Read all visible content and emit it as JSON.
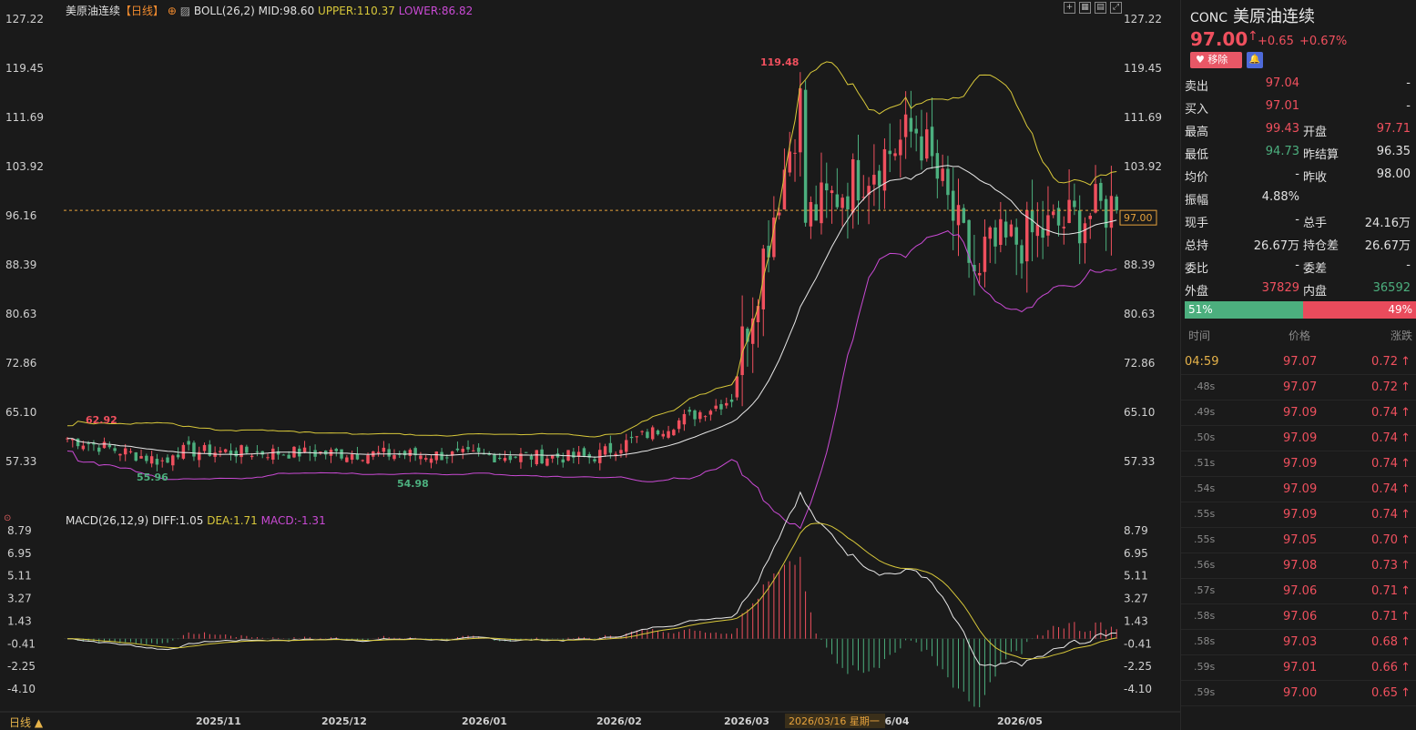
{
  "chart_header": {
    "symbol_label": "美原油连续",
    "period_label": "【日线】",
    "add_icon": "plus-circle-icon",
    "boll_label": "BOLL(26,2)",
    "boll_mid": "MID:98.60",
    "boll_upper": "UPPER:110.37",
    "boll_lower": "LOWER:86.82",
    "macd_label": "MACD(26,12,9)",
    "macd_diff": "DIFF:1.05",
    "macd_dea": "DEA:1.71",
    "macd_macd": "MACD:-1.31",
    "bottom_tab": "日线 ▲",
    "cursor_date": "2026/03/16 星期一"
  },
  "chart_data": [
    {
      "type": "candlestick",
      "title": "美原油连续【日线】",
      "y_ticks": [
        "127.22",
        "119.45",
        "111.69",
        "103.92",
        "96.16",
        "88.39",
        "80.63",
        "72.86",
        "65.10",
        "57.33"
      ],
      "ylim": [
        57.33,
        127.22
      ],
      "x_ticks": [
        "2025/11",
        "2025/12",
        "2026/01",
        "2026/02",
        "2026/03",
        "6/04",
        "2026/05"
      ],
      "annotations": [
        {
          "label": "119.48",
          "color": "#f0505e"
        },
        {
          "label": "62.92",
          "color": "#f0505e"
        },
        {
          "label": "55.96",
          "color": "#4caf7e"
        },
        {
          "label": "54.98",
          "color": "#4caf7e"
        }
      ],
      "current_price_label": "97.00",
      "current_price": 97.0,
      "series": [
        {
          "name": "UPPER",
          "color": "#d8c83a"
        },
        {
          "name": "MID",
          "color": "#e8e8e8"
        },
        {
          "name": "LOWER",
          "color": "#c94ad4"
        }
      ],
      "phases": [
        {
          "start": 0,
          "end": 0.1,
          "from": 61,
          "to": 57
        },
        {
          "start": 0.1,
          "end": 0.5,
          "from": 59,
          "to": 58
        },
        {
          "start": 0.5,
          "end": 0.63,
          "from": 58,
          "to": 67
        },
        {
          "start": 0.63,
          "end": 0.7,
          "from": 67,
          "to": 115
        },
        {
          "start": 0.7,
          "end": 0.81,
          "from": 95,
          "to": 110
        },
        {
          "start": 0.81,
          "end": 0.87,
          "from": 110,
          "to": 85
        },
        {
          "start": 0.87,
          "end": 1,
          "from": 90,
          "to": 98
        }
      ]
    },
    {
      "type": "bar",
      "title": "MACD(26,12,9)",
      "y_ticks": [
        "8.79",
        "6.95",
        "5.11",
        "3.27",
        "1.43",
        "-0.41",
        "-2.25",
        "-4.10"
      ],
      "ylim": [
        -4.1,
        8.79
      ],
      "series": [
        {
          "name": "DIFF",
          "color": "#e8e8e8"
        },
        {
          "name": "DEA",
          "color": "#d8c83a"
        },
        {
          "name": "MACD",
          "color": "#c94ad4"
        }
      ]
    }
  ],
  "panel": {
    "code": "CONC",
    "name": "美原油连续",
    "price": "97.00",
    "arrow": "↑",
    "change": "+0.65",
    "change_pct": "+0.67%",
    "remove_label": "移除",
    "remove_icon": "heart-icon",
    "bell_icon": "bell-icon",
    "quotes": [
      {
        "l1": "卖出",
        "v1": "97.04",
        "c1": "red",
        "l2": "",
        "v2": "-",
        "c2": "white"
      },
      {
        "l1": "买入",
        "v1": "97.01",
        "c1": "red",
        "l2": "",
        "v2": "-",
        "c2": "white"
      },
      {
        "l1": "最高",
        "v1": "99.43",
        "c1": "red",
        "l2": "开盘",
        "v2": "97.71",
        "c2": "red"
      },
      {
        "l1": "最低",
        "v1": "94.73",
        "c1": "green",
        "l2": "昨结算",
        "v2": "96.35",
        "c2": "white"
      },
      {
        "l1": "均价",
        "v1": "-",
        "c1": "white",
        "l2": "昨收",
        "v2": "98.00",
        "c2": "white"
      },
      {
        "l1": "振幅",
        "v1": "4.88%",
        "c1": "white",
        "l2": "",
        "v2": "",
        "c2": "white"
      },
      {
        "l1": "现手",
        "v1": "-",
        "c1": "white",
        "l2": "总手",
        "v2": "24.16万",
        "c2": "white"
      },
      {
        "l1": "总持",
        "v1": "26.67万",
        "c1": "white",
        "l2": "持仓差",
        "v2": "26.67万",
        "c2": "white"
      },
      {
        "l1": "委比",
        "v1": "-",
        "c1": "white",
        "l2": "委差",
        "v2": "-",
        "c2": "white"
      },
      {
        "l1": "外盘",
        "v1": "37829",
        "c1": "red",
        "l2": "内盘",
        "v2": "36592",
        "c2": "green"
      }
    ],
    "buy_pct": "51%",
    "sell_pct": "49%",
    "buy_ratio": 0.51,
    "trade_headers": {
      "time": "时间",
      "price": "价格",
      "change": "涨跌"
    },
    "trades": [
      {
        "time": "04:59",
        "price": "97.07",
        "change": "0.72"
      },
      {
        "time": ".48s",
        "price": "97.07",
        "change": "0.72"
      },
      {
        "time": ".49s",
        "price": "97.09",
        "change": "0.74"
      },
      {
        "time": ".50s",
        "price": "97.09",
        "change": "0.74"
      },
      {
        "time": ".51s",
        "price": "97.09",
        "change": "0.74"
      },
      {
        "time": ".54s",
        "price": "97.09",
        "change": "0.74"
      },
      {
        "time": ".55s",
        "price": "97.09",
        "change": "0.74"
      },
      {
        "time": ".55s",
        "price": "97.05",
        "change": "0.70"
      },
      {
        "time": ".56s",
        "price": "97.08",
        "change": "0.73"
      },
      {
        "time": ".57s",
        "price": "97.06",
        "change": "0.71"
      },
      {
        "time": ".58s",
        "price": "97.06",
        "change": "0.71"
      },
      {
        "time": ".58s",
        "price": "97.03",
        "change": "0.68"
      },
      {
        "time": ".59s",
        "price": "97.01",
        "change": "0.66"
      },
      {
        "time": ".59s",
        "price": "97.00",
        "change": "0.65"
      }
    ],
    "up_arrow": "↑"
  }
}
